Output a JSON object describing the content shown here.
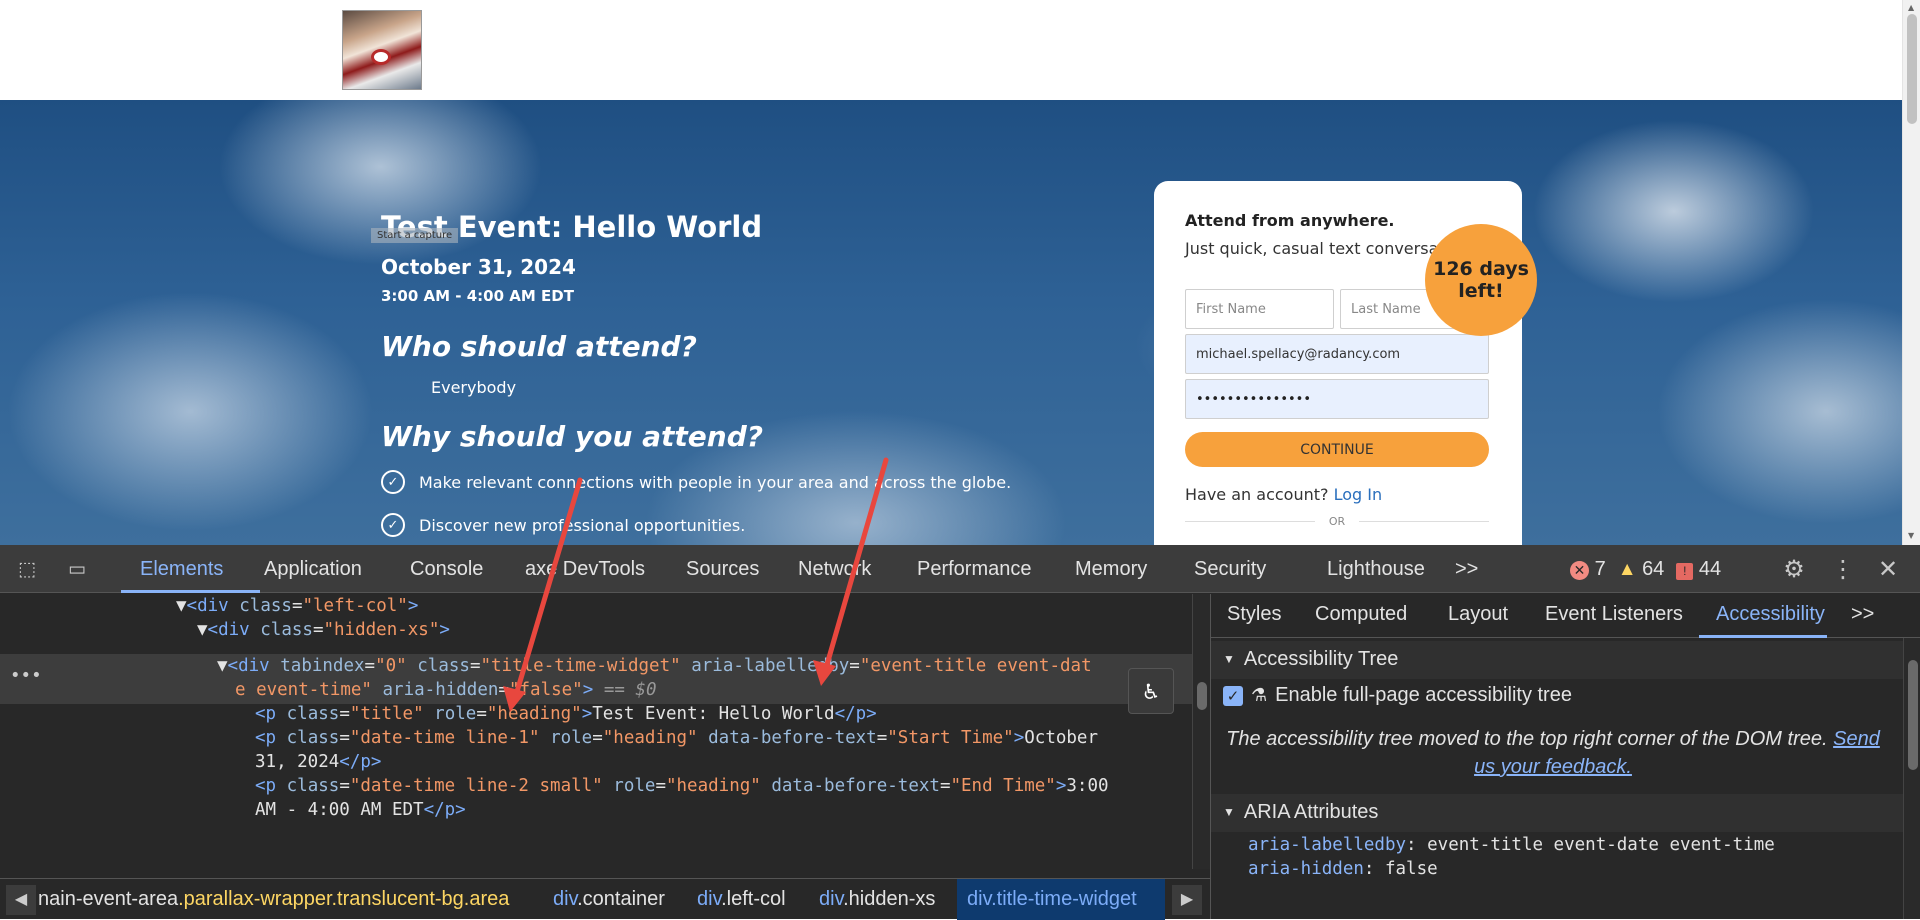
{
  "page": {
    "capture_label": "Start a capture",
    "event_title": "Test Event: Hello World",
    "event_date": "October 31, 2024",
    "event_time": "3:00 AM - 4:00 AM EDT",
    "who_heading": "Who should attend?",
    "who_answer": "Everybody",
    "why_heading": "Why should you attend?",
    "bullets": [
      "Make relevant connections with people in your area and across the globe.",
      "Discover new professional opportunities."
    ],
    "badge": "126 days left!",
    "form": {
      "heading": "Attend from anywhere.",
      "subheading": "Just quick, casual text conversations.",
      "first_name_placeholder": "First Name",
      "last_name_placeholder": "Last Name",
      "email_value": "michael.spellacy@radancy.com",
      "password_value": "•••••••••••••••",
      "continue_label": "CONTINUE",
      "have_account": "Have an account?",
      "login_label": "Log In",
      "or_label": "OR"
    }
  },
  "devtools": {
    "tabs": [
      "Elements",
      "Application",
      "Console",
      "axe DevTools",
      "Sources",
      "Network",
      "Performance",
      "Memory",
      "Security",
      "Lighthouse"
    ],
    "more": ">>",
    "errors": "7",
    "warnings": "64",
    "issues": "44",
    "dom_lines": {
      "l1_tag": "<div",
      "l1_attr": "class",
      "l1_val": "\"left-col\"",
      "l2_val": "\"hidden-xs\"",
      "l3_tabindex": "tabindex",
      "l3_tabindex_val": "\"0\"",
      "l3_class_val": "\"title-time-widget\"",
      "l3_labelledby": "aria-labelledby",
      "l3_labelledby_val": "\"event-title event-dat",
      "l3_cont_val": "e event-time\"",
      "l3_hidden": "aria-hidden",
      "l3_hidden_val": "\"false\"",
      "l3_dollar": "== $0",
      "p_title_class": "\"title\"",
      "p_role": "role",
      "p_heading": "\"heading\"",
      "p_title_text": "Test Event: Hello World",
      "p_line1_class": "\"date-time line-1\"",
      "p_before": "data-before-text",
      "p_line1_before": "\"Start Time\"",
      "p_line1_text": "October",
      "p_line1_text2": "31, 2024",
      "p_line2_class": "\"date-time line-2 small\"",
      "p_line2_before": "\"End Time\"",
      "p_line2_text": "3:00",
      "p_line2_text2": "AM - 4:00 AM EDT"
    },
    "breadcrumbs": [
      {
        "tag": "",
        "cls": "nain-event-area",
        "extra": ".parallax-wrapper.translucent-bg.area"
      },
      {
        "tag": "div",
        "cls": ".container"
      },
      {
        "tag": "div",
        "cls": ".left-col"
      },
      {
        "tag": "div",
        "cls": ".hidden-xs"
      },
      {
        "tag": "div",
        "cls": ".title-time-widget"
      }
    ],
    "side_tabs": [
      "Styles",
      "Computed",
      "Layout",
      "Event Listeners",
      "Accessibility"
    ],
    "accessibility": {
      "tree_heading": "Accessibility Tree",
      "enable_label": "Enable full-page accessibility tree",
      "note": "The accessibility tree moved to the top right corner of the DOM tree.",
      "feedback_link": "Send us your feedback.",
      "aria_heading": "ARIA Attributes",
      "aria": [
        {
          "key": "aria-labelledby",
          "value": "event-title event-date event-time"
        },
        {
          "key": "aria-hidden",
          "value": "false"
        }
      ]
    }
  },
  "colors": {
    "accent_orange": "#f7a13c",
    "devtools_blue": "#8ab4f8",
    "annotation_red": "#e8473e"
  }
}
